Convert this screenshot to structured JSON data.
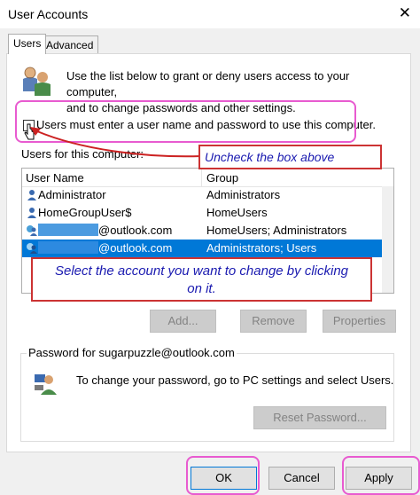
{
  "window": {
    "title": "User Accounts",
    "close_glyph": "✕"
  },
  "tabs": [
    {
      "label": "Users"
    },
    {
      "label": "Advanced"
    }
  ],
  "intro": {
    "line1": "Use the list below to grant or deny users access to your computer,",
    "line2": "and to change passwords and other settings."
  },
  "login_checkbox": {
    "label": "Users must enter a user name and password to use this computer.",
    "checked": false
  },
  "users_section": {
    "label": "Users for this computer:",
    "columns": {
      "name": "User Name",
      "group": "Group"
    },
    "rows": [
      {
        "name": "Administrator",
        "group": "Administrators",
        "icon": "user-icon"
      },
      {
        "name": "HomeGroupUser$",
        "group": "HomeUsers",
        "icon": "user-icon"
      },
      {
        "name": "@outlook.com",
        "group": "HomeUsers; Administrators",
        "icon": "user-globe-icon"
      },
      {
        "name": "@outlook.com",
        "group": "Administrators; Users",
        "icon": "user-globe-icon",
        "selected": true
      }
    ]
  },
  "buttons": {
    "add": "Add...",
    "remove": "Remove",
    "properties": "Properties",
    "reset_password": "Reset Password...",
    "ok": "OK",
    "cancel": "Cancel",
    "apply": "Apply"
  },
  "password_group": {
    "title": "Password for sugarpuzzle@outlook.com",
    "text": "To change your password, go to PC settings and select Users."
  },
  "annotations": {
    "uncheck": "Uncheck the box above",
    "select_line1": "Select the account you want to change by clicking",
    "select_line2": "on it."
  },
  "colors": {
    "selection": "#0078d7",
    "annotation_border": "#cc3333",
    "highlight": "#e85bd0",
    "annotation_text": "#1a1ab0"
  }
}
